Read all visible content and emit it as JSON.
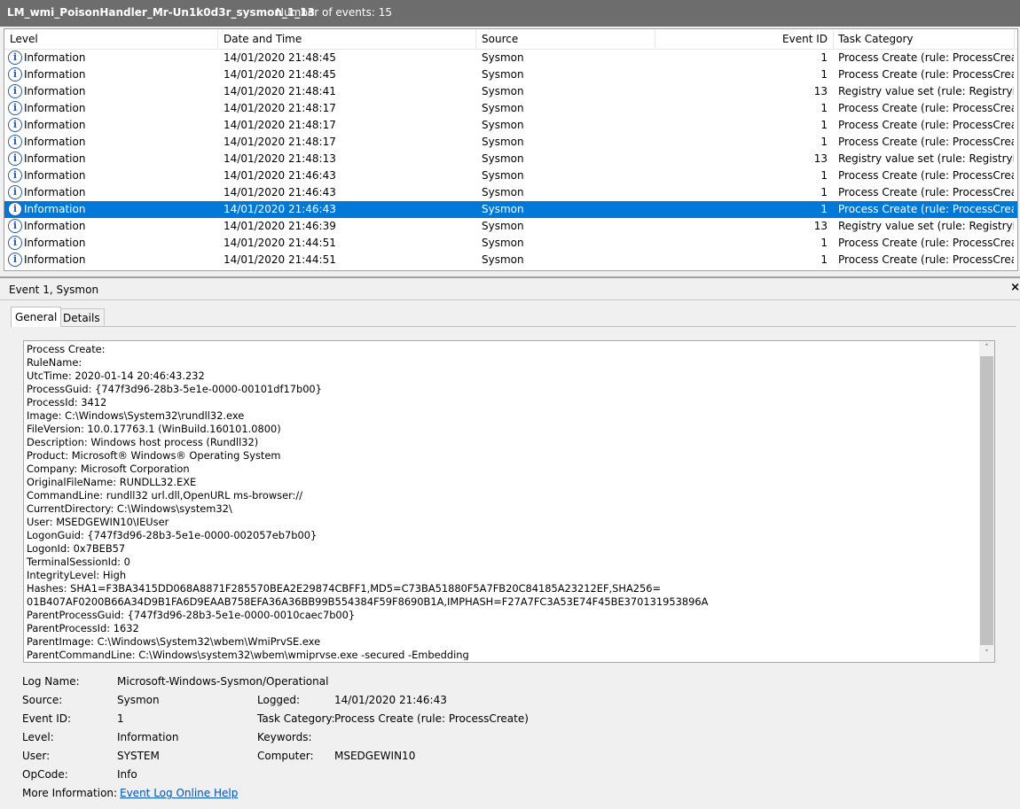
{
  "window": {
    "log_name": "LM_wmi_PoisonHandler_Mr-Un1k0d3r_sysmon_1_13",
    "event_count": "Number of events: 15"
  },
  "grid": {
    "columns": [
      "Level",
      "Date and Time",
      "Source",
      "Event ID",
      "Task Category"
    ],
    "rows": [
      {
        "level": "Information",
        "datetime": "14/01/2020 21:48:45",
        "source": "Sysmon",
        "event_id": "1",
        "task": "Process Create (rule: ProcessCreate)"
      },
      {
        "level": "Information",
        "datetime": "14/01/2020 21:48:45",
        "source": "Sysmon",
        "event_id": "1",
        "task": "Process Create (rule: ProcessCreate)"
      },
      {
        "level": "Information",
        "datetime": "14/01/2020 21:48:41",
        "source": "Sysmon",
        "event_id": "13",
        "task": "Registry value set (rule: RegistryEve..."
      },
      {
        "level": "Information",
        "datetime": "14/01/2020 21:48:17",
        "source": "Sysmon",
        "event_id": "1",
        "task": "Process Create (rule: ProcessCreate)"
      },
      {
        "level": "Information",
        "datetime": "14/01/2020 21:48:17",
        "source": "Sysmon",
        "event_id": "1",
        "task": "Process Create (rule: ProcessCreate)"
      },
      {
        "level": "Information",
        "datetime": "14/01/2020 21:48:17",
        "source": "Sysmon",
        "event_id": "1",
        "task": "Process Create (rule: ProcessCreate)"
      },
      {
        "level": "Information",
        "datetime": "14/01/2020 21:48:13",
        "source": "Sysmon",
        "event_id": "13",
        "task": "Registry value set (rule: RegistryEve..."
      },
      {
        "level": "Information",
        "datetime": "14/01/2020 21:46:43",
        "source": "Sysmon",
        "event_id": "1",
        "task": "Process Create (rule: ProcessCreate)"
      },
      {
        "level": "Information",
        "datetime": "14/01/2020 21:46:43",
        "source": "Sysmon",
        "event_id": "1",
        "task": "Process Create (rule: ProcessCreate)"
      },
      {
        "level": "Information",
        "datetime": "14/01/2020 21:46:43",
        "source": "Sysmon",
        "event_id": "1",
        "task": "Process Create (rule: ProcessCreate)",
        "selected": true
      },
      {
        "level": "Information",
        "datetime": "14/01/2020 21:46:39",
        "source": "Sysmon",
        "event_id": "13",
        "task": "Registry value set (rule: RegistryEve..."
      },
      {
        "level": "Information",
        "datetime": "14/01/2020 21:44:51",
        "source": "Sysmon",
        "event_id": "1",
        "task": "Process Create (rule: ProcessCreate)"
      },
      {
        "level": "Information",
        "datetime": "14/01/2020 21:44:51",
        "source": "Sysmon",
        "event_id": "1",
        "task": "Process Create (rule: ProcessCreate)"
      }
    ]
  },
  "detail": {
    "title": "Event 1, Sysmon",
    "close_glyph": "×",
    "tabs": [
      "General",
      "Details"
    ],
    "description_lines": [
      "Process Create:",
      "RuleName:",
      "UtcTime: 2020-01-14 20:46:43.232",
      "ProcessGuid: {747f3d96-28b3-5e1e-0000-00101df17b00}",
      "ProcessId: 3412",
      "Image: C:\\Windows\\System32\\rundll32.exe",
      "FileVersion: 10.0.17763.1 (WinBuild.160101.0800)",
      "Description: Windows host process (Rundll32)",
      "Product: Microsoft® Windows® Operating System",
      "Company: Microsoft Corporation",
      "OriginalFileName: RUNDLL32.EXE",
      "CommandLine: rundll32 url.dll,OpenURL ms-browser://",
      "CurrentDirectory: C:\\Windows\\system32\\",
      "User: MSEDGEWIN10\\IEUser",
      "LogonGuid: {747f3d96-28b3-5e1e-0000-002057eb7b00}",
      "LogonId: 0x7BEB57",
      "TerminalSessionId: 0",
      "IntegrityLevel: High",
      "Hashes: SHA1=F3BA3415DD068A8871F285570BEA2E29874CBFF1,MD5=C73BA51880F5A7FB20C84185A23212EF,SHA256=",
      "01B407AF0200B66A34D9B1FA6D9EAAB758EFA36A36BB99B554384F59F8690B1A,IMPHASH=F27A7FC3A53E74F45BE370131953896A",
      "ParentProcessGuid: {747f3d96-28b3-5e1e-0000-0010caec7b00}",
      "ParentProcessId: 1632",
      "ParentImage: C:\\Windows\\System32\\wbem\\WmiPrvSE.exe",
      "ParentCommandLine: C:\\Windows\\system32\\wbem\\wmiprvse.exe -secured -Embedding"
    ],
    "scroll_up": "˄",
    "scroll_down": "˅",
    "fields": {
      "log_name_label": "Log Name:",
      "log_name_value": "Microsoft-Windows-Sysmon/Operational",
      "source_label": "Source:",
      "source_value": "Sysmon",
      "logged_label": "Logged:",
      "logged_value": "14/01/2020 21:46:43",
      "event_id_label": "Event ID:",
      "event_id_value": "1",
      "task_label": "Task Category:",
      "task_value": "Process Create (rule: ProcessCreate)",
      "level_label": "Level:",
      "level_value": "Information",
      "keywords_label": "Keywords:",
      "keywords_value": "",
      "user_label": "User:",
      "user_value": "SYSTEM",
      "computer_label": "Computer:",
      "computer_value": "MSEDGEWIN10",
      "opcode_label": "OpCode:",
      "opcode_value": "Info",
      "more_info_label": "More Information:",
      "more_info_link": "Event Log Online Help"
    }
  },
  "colors": {
    "selected_row": "#0078d7",
    "title_bar": "#6d6d6d",
    "link": "#0050c0"
  },
  "icons": {
    "level_icon": "information-icon"
  }
}
